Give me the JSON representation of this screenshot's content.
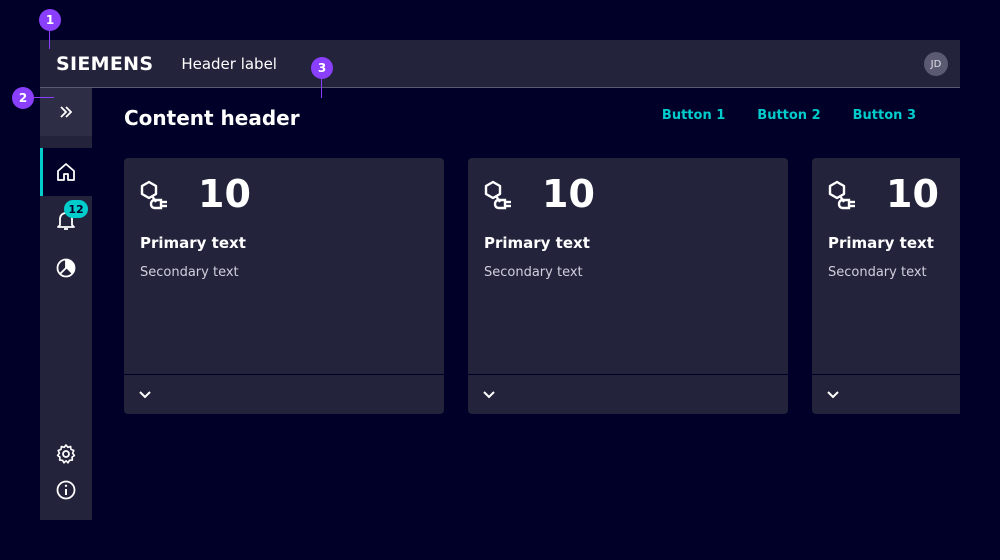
{
  "annotations": [
    "1",
    "2",
    "3"
  ],
  "header": {
    "logo": "SIEMENS",
    "label": "Header label",
    "avatar_initials": "JD"
  },
  "sidebar": {
    "items": [
      {
        "icon": "double-chevron-right-icon"
      },
      {
        "icon": "home-icon",
        "active": true
      },
      {
        "icon": "bell-icon",
        "badge": "12"
      },
      {
        "icon": "pie-chart-icon"
      },
      {
        "icon": "gear-icon"
      },
      {
        "icon": "info-icon"
      }
    ]
  },
  "content": {
    "title": "Content header",
    "buttons": [
      "Button 1",
      "Button 2",
      "Button 3"
    ],
    "cards": [
      {
        "icon": "plug-icon",
        "value": "10",
        "primary": "Primary text",
        "secondary": "Secondary text"
      },
      {
        "icon": "plug-icon",
        "value": "10",
        "primary": "Primary text",
        "secondary": "Secondary text"
      },
      {
        "icon": "plug-icon",
        "value": "10",
        "primary": "Primary text",
        "secondary": "Secondary text"
      }
    ]
  },
  "colors": {
    "background": "#000028",
    "surface": "#23233c",
    "accent": "#00cccc",
    "annotation": "#8a3ffc"
  }
}
